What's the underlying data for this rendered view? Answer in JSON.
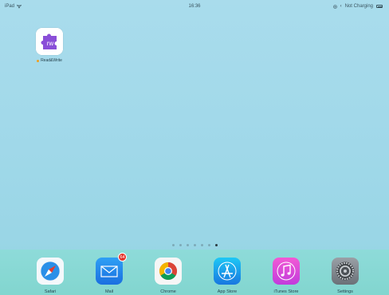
{
  "status_bar": {
    "device": "iPad",
    "time": "16:36",
    "charging": "Not Charging"
  },
  "home": {
    "apps": [
      {
        "label": "Read&Write",
        "icon": "read-write-icon",
        "new": true
      }
    ],
    "page_dots": {
      "count": 7,
      "active_index": 6
    }
  },
  "dock": {
    "apps": [
      {
        "label": "Safari",
        "icon": "safari-icon"
      },
      {
        "label": "Mail",
        "icon": "mail-icon",
        "badge": "64"
      },
      {
        "label": "Chrome",
        "icon": "chrome-icon"
      },
      {
        "label": "App Store",
        "icon": "app-store-icon"
      },
      {
        "label": "iTunes Store",
        "icon": "itunes-store-icon"
      },
      {
        "label": "Settings",
        "icon": "settings-icon"
      }
    ]
  },
  "colors": {
    "wallpaper": "#a2d9ea",
    "dock": "#80d6cd",
    "badge": "#e5332a",
    "readwrite_purple": "#8a4fd8"
  }
}
